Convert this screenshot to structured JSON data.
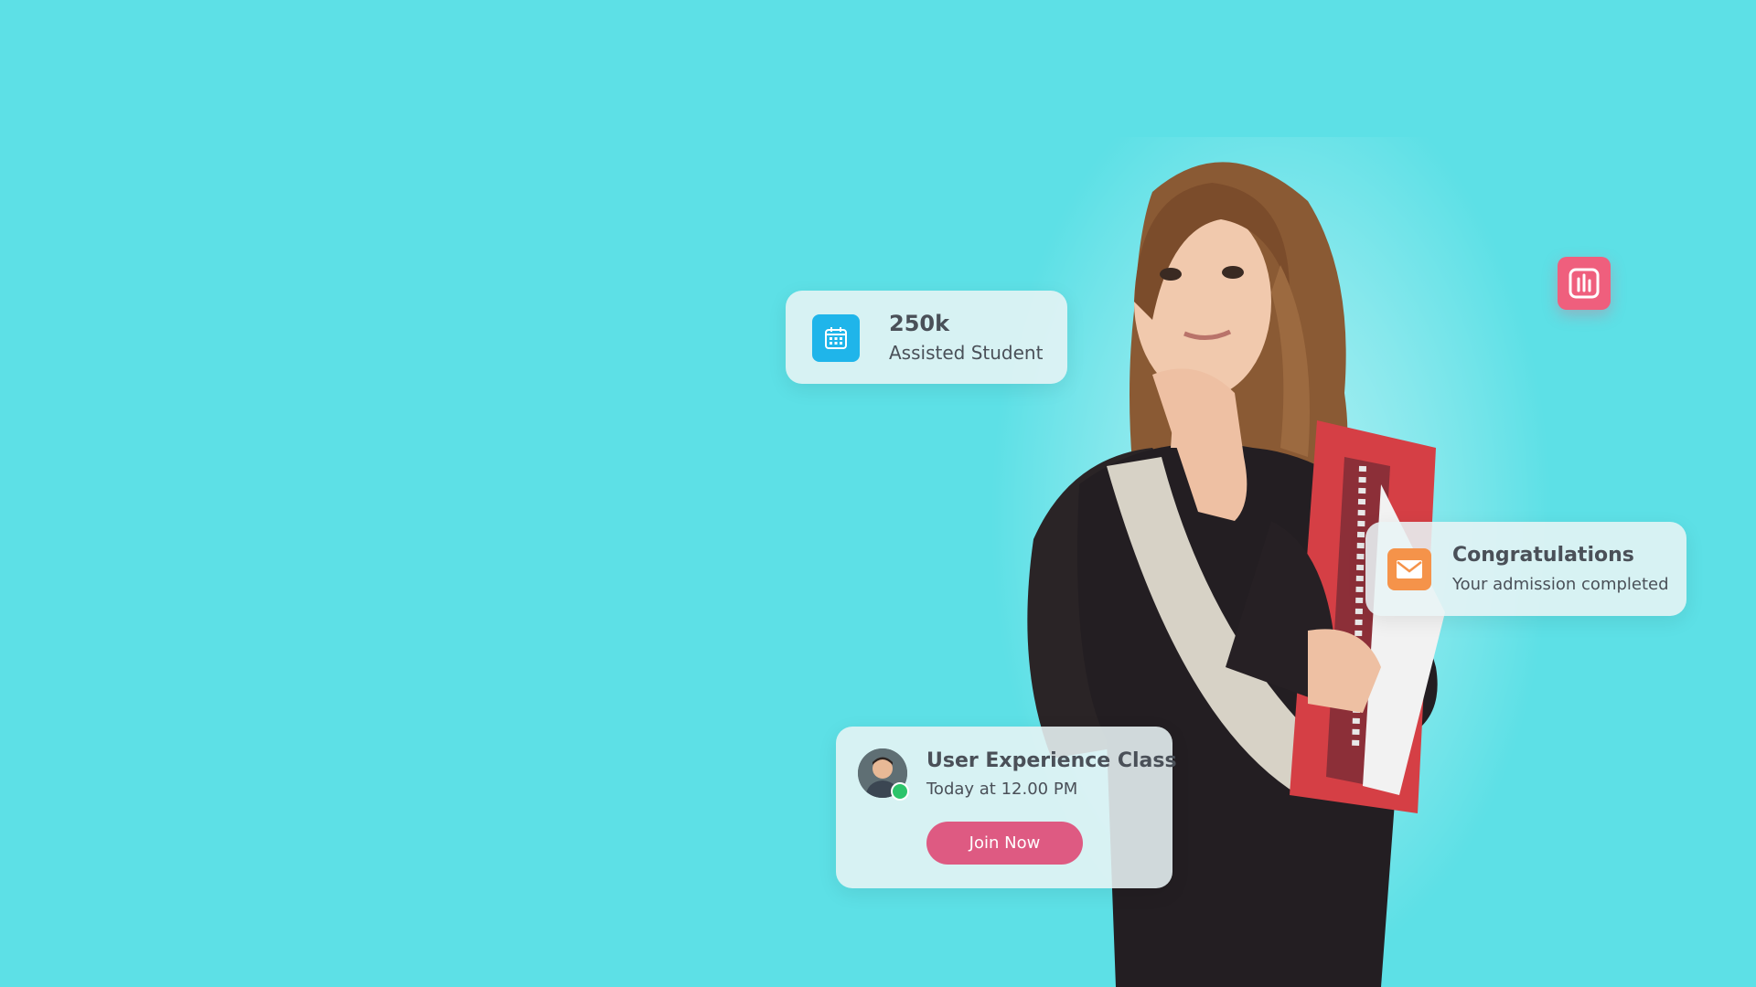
{
  "stat_card": {
    "value": "250k",
    "label": "Assisted Student",
    "icon": "calendar-icon"
  },
  "notice_card": {
    "title": "Congratulations",
    "subtitle": "Your admission completed",
    "icon": "mail-icon"
  },
  "class_card": {
    "title": "User Experience Class",
    "time": "Today at 12.00 PM",
    "button_label": "Join Now",
    "status": "online"
  },
  "chart_badge": {
    "icon": "bar-chart-icon"
  },
  "colors": {
    "background": "#5de0e6",
    "calendar_icon_bg": "#1fb5ea",
    "mail_icon_bg": "#f5934a",
    "join_button": "#de5a82",
    "chart_badge": "#ef5f7d",
    "online": "#2cc46a"
  }
}
